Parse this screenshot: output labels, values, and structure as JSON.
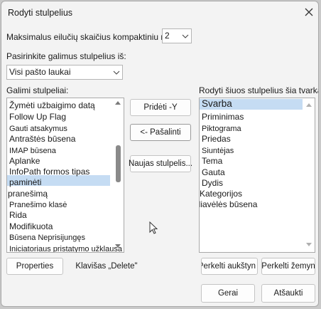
{
  "window": {
    "title": "Rodyti stulpelius"
  },
  "max_lines": {
    "label": "Maksimalus eilučių skaičius kompaktiniu režimu:",
    "value": "2"
  },
  "available_from": {
    "label": "Pasirinkite galimus stulpelius iš:",
    "value": "Visi pašto laukai"
  },
  "available": {
    "label": "Galimi stulpeliai:",
    "items": [
      "Žymėti užbaigimo datą",
      "Follow Up Flag",
      "Gauti atsakymus",
      "Antraštės būsena",
      "IMAP būsena",
      "Aplanke",
      "InfoPath formos tipas",
      "paminėti",
      "pranešimą",
      "Pranešimo klasė",
      "Rida",
      "Modifikuota",
      "Būsena Neprisijungęs",
      "Iniciatoriaus pristatymo užklausa"
    ]
  },
  "shown": {
    "label": "Rodyti šiuos stulpelius šia tvarka:",
    "items": [
      "Svarba",
      "Priminimas",
      "Piktograma",
      "Priedas",
      "Siuntėjas",
      "Tema",
      "Gauta",
      "Dydis",
      "Kategorijos",
      "Vėliavėlės būsena"
    ]
  },
  "buttons": {
    "add": "Pridėti -Y",
    "remove": "<- Pašalinti",
    "new_column": "Naujas stulpelis...",
    "properties": "Properties",
    "delete_key": "Klavišas „Delete\"",
    "move_up": "Perkelti aukštyn",
    "move_down": "Perkelti žemyn",
    "ok": "Gerai",
    "cancel": "Atšaukti"
  },
  "colors": {
    "selection": "#c5dcf3",
    "dialog_bg": "#f3f3f3",
    "thumb": "#8a8a8a"
  }
}
